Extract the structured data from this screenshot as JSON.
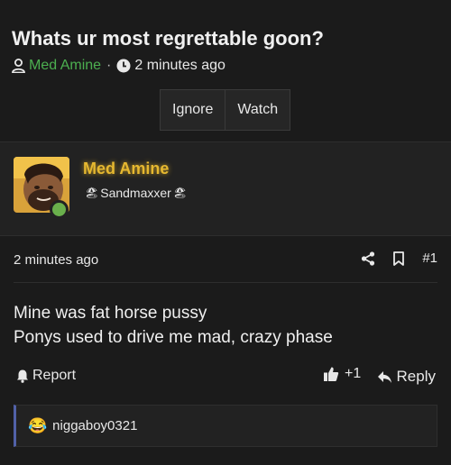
{
  "thread": {
    "title": "Whats ur most regrettable goon?",
    "author": "Med Amine",
    "separator": "·",
    "time": "2 minutes ago",
    "ignore_label": "Ignore",
    "watch_label": "Watch"
  },
  "post": {
    "username": "Med Amine",
    "user_title": "Sandmaxxer",
    "time": "2 minutes ago",
    "number": "#1",
    "body": [
      "Mine was fat horse pussy",
      "Ponys used to drive me mad, crazy phase"
    ],
    "report_label": "Report",
    "reaction_count": "+1",
    "reply_label": "Reply",
    "reactors": "niggaboy0321",
    "reaction_emoji": "😂"
  },
  "colors": {
    "background": "#1b1b1b",
    "author_link": "#4caf50",
    "username": "#e6b830",
    "online": "#6ab04c",
    "reaction_bar": "#5161a8"
  },
  "icons": [
    "user-icon",
    "clock-icon",
    "share-icon",
    "bookmark-icon",
    "report-icon",
    "like-icon",
    "reply-icon"
  ]
}
